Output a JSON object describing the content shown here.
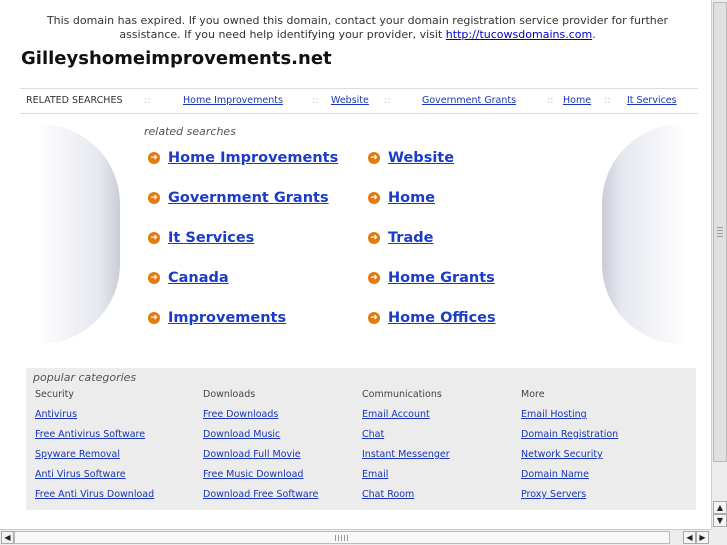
{
  "notice": {
    "text": "This domain has expired. If you owned this domain, contact your domain registration service provider for further assistance. If you need help identifying your provider, visit ",
    "link": "http://tucowsdomains.com",
    "end": "."
  },
  "domain_title": "Gilleyshomeimprovements.net",
  "related_bar": {
    "label": "RELATED SEARCHES",
    "separator": "::",
    "links": [
      "Home Improvements",
      "Website",
      "Government Grants",
      "Home",
      "It Services"
    ]
  },
  "related_searches": {
    "title": "related searches",
    "arrow_glyph": "➜",
    "left": [
      "Home Improvements",
      "Government Grants",
      "It Services",
      "Canada",
      "Improvements"
    ],
    "right": [
      "Website",
      "Home",
      "Trade",
      "Home Grants",
      "Home Offices"
    ]
  },
  "popular": {
    "title": "popular categories",
    "columns": [
      {
        "heading": "Security",
        "links": [
          "Antivirus",
          "Free Antivirus Software",
          "Spyware Removal",
          "Anti Virus Software",
          "Free Anti Virus Download"
        ]
      },
      {
        "heading": "Downloads",
        "links": [
          "Free Downloads",
          "Download Music",
          "Download Full Movie",
          "Free Music Download",
          "Download Free Software"
        ]
      },
      {
        "heading": "Communications",
        "links": [
          "Email Account",
          "Chat",
          "Instant Messenger",
          "Email",
          "Chat Room"
        ]
      },
      {
        "heading": "More",
        "links": [
          "Email Hosting",
          "Domain Registration",
          "Network Security",
          "Domain Name",
          "Proxy Servers"
        ]
      }
    ]
  },
  "scrollbar": {
    "up": "▲",
    "down": "▼",
    "left": "◀",
    "right": "▶"
  },
  "colors": {
    "link": "#1a3cc8",
    "arrow": "#e07b10",
    "panel": "#ececec"
  }
}
